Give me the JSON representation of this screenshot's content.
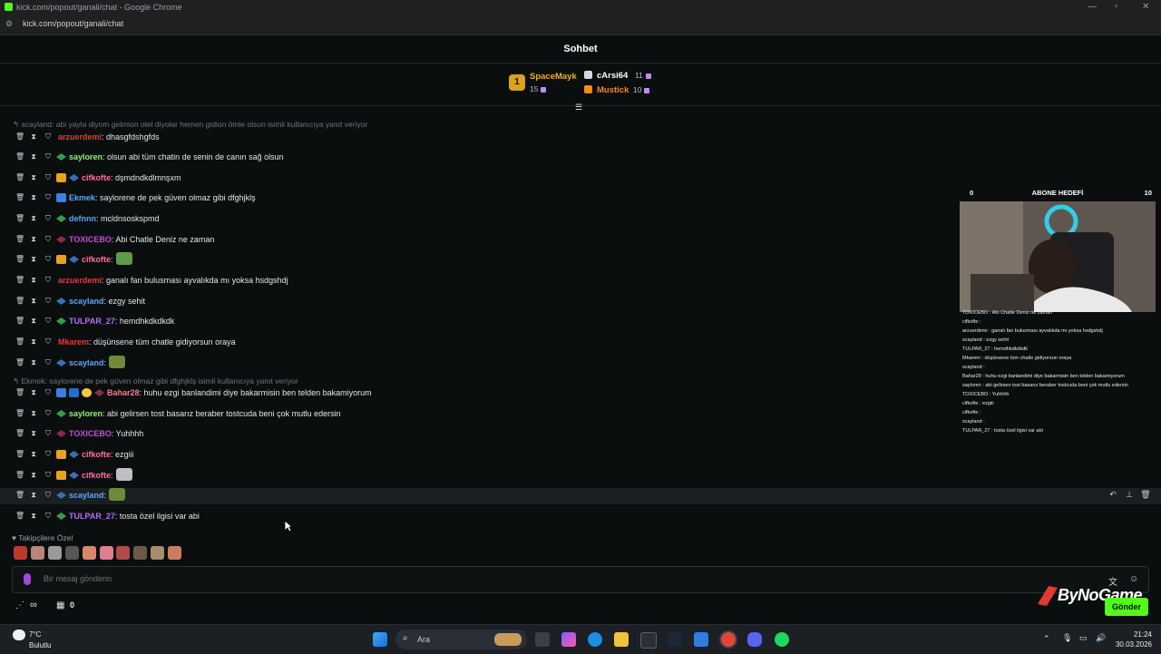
{
  "window": {
    "title": "kick.com/popout/ganali/chat - Google Chrome",
    "url": "kick.com/popout/ganali/chat"
  },
  "chat": {
    "title": "Sohbet"
  },
  "leaderboard": {
    "rank_label": "1",
    "entries": [
      {
        "name": "SpaceMayk",
        "count": "15",
        "color": "#f0b21e"
      },
      {
        "name": "cArsi64",
        "count": "11",
        "color": "#ffffff"
      },
      {
        "name": "Mustick",
        "count": "10",
        "color": "#f28a1f"
      }
    ]
  },
  "reply1": "scayland: abi yayla diyom gelmion otel diyolar hemen gidion ömle olsun isimli kullanıcıya yanıt veriyor",
  "reply2": "Ekmek: saylorene de pek güven olmaz gibi dfghjklş isimli kullanıcıya yanıt veriyor",
  "messages": [
    {
      "user": "arzuerdemi",
      "color": "#e43a3a",
      "text": ": dhasgfdshgfds"
    },
    {
      "user": "sayloren",
      "color": "#8ff07a",
      "text": ": olsun abi tüm chatin de senin de canın sağ olsun"
    },
    {
      "user": "cifkofte",
      "color": "#ff6fa0",
      "text": ": dşmdndkdlmnşxm"
    },
    {
      "user": "Ekmek",
      "color": "#5aa6ff",
      "text": ": saylorene de pek güven olmaz gibi dfghjklş"
    },
    {
      "user": "defnnn",
      "color": "#5aa6ff",
      "text": ": mcldnsosksрmd"
    },
    {
      "user": "TOXICEBO",
      "color": "#c44bd6",
      "text": ": Abi Chatle Deniz ne zaman"
    },
    {
      "user": "cifkofte",
      "color": "#ff6fa0",
      "text": ":"
    },
    {
      "user": "arzuerdemi",
      "color": "#e43a3a",
      "text": ": ganalı fan bulusması ayvalıkda mı yoksa hsdgshdj"
    },
    {
      "user": "scayland",
      "color": "#5aa6ff",
      "text": ": ezgy sehit"
    },
    {
      "user": "TULPAR_27",
      "color": "#b46bff",
      "text": ": hemdhkdkdkdk"
    },
    {
      "user": "Mkarem",
      "color": "#e43a3a",
      "text": ": düşünsene tüm chatle gidiyorsun oraya"
    },
    {
      "user": "scayland",
      "color": "#5aa6ff",
      "text": ":"
    },
    {
      "user": "Bahar28",
      "color": "#ff7a8a",
      "text": ": huhu ezgi banlandimi diye bakarmisin ben telden bakamiyorum"
    },
    {
      "user": "sayloren",
      "color": "#8ff07a",
      "text": ": abi gelirsen tost basarız beraber tostcuda beni çok mutlu edersin"
    },
    {
      "user": "TOXICEBO",
      "color": "#c44bd6",
      "text": ": Yuhhhh"
    },
    {
      "user": "cifkofte",
      "color": "#ff6fa0",
      "text": ": ezgiii"
    },
    {
      "user": "cifkofte",
      "color": "#ff6fa0",
      "text": ":"
    },
    {
      "user": "scayland",
      "color": "#5aa6ff",
      "text": ":"
    },
    {
      "user": "TULPAR_27",
      "color": "#b46bff",
      "text": ": tosta özel ilgisi var abi"
    }
  ],
  "followers_only": "Takipçilere Özel",
  "input": {
    "placeholder": "Bir mesaj gönderin"
  },
  "bottom": {
    "infinity": "∞",
    "count": "0"
  },
  "send_label": "Gönder",
  "brand": "ByNoGame",
  "sub_goal": {
    "left": "0",
    "title": "ABONE HEDEFİ",
    "right": "10"
  },
  "overlay_chat": [
    "TOXICEBO : Abi Chatle Deniz ne zaman",
    "cifkofte :",
    "arzuerdemi : ganalı fan bulusması ayvalıkda mı yoksa hsdgshdj",
    "scayland : ezgy sehit",
    "TULPAR_27 : hemdhkdkdkdk",
    "Mkarem : düşünsene tüm chatle gidiyorsun oraya",
    "scayland :",
    "Bahar28 : huhu ezgi banlandimi diye bakarmisin ben telden bakamiyorum",
    "sayloren : abi gelirsen tost basarız beraber tostcuda beni çok mutlu edersin",
    "TOXICEBO : Yuhhhh",
    "cifkofte : ezgiii",
    "cifkofte :",
    "scayland :",
    "TULPAR_27 : tosta özel ilgisi var abi"
  ],
  "taskbar": {
    "weather_temp": "7°C",
    "weather_desc": "Bulutlu",
    "search": "Ara",
    "time": "21:24",
    "date": "30.03.2026"
  }
}
